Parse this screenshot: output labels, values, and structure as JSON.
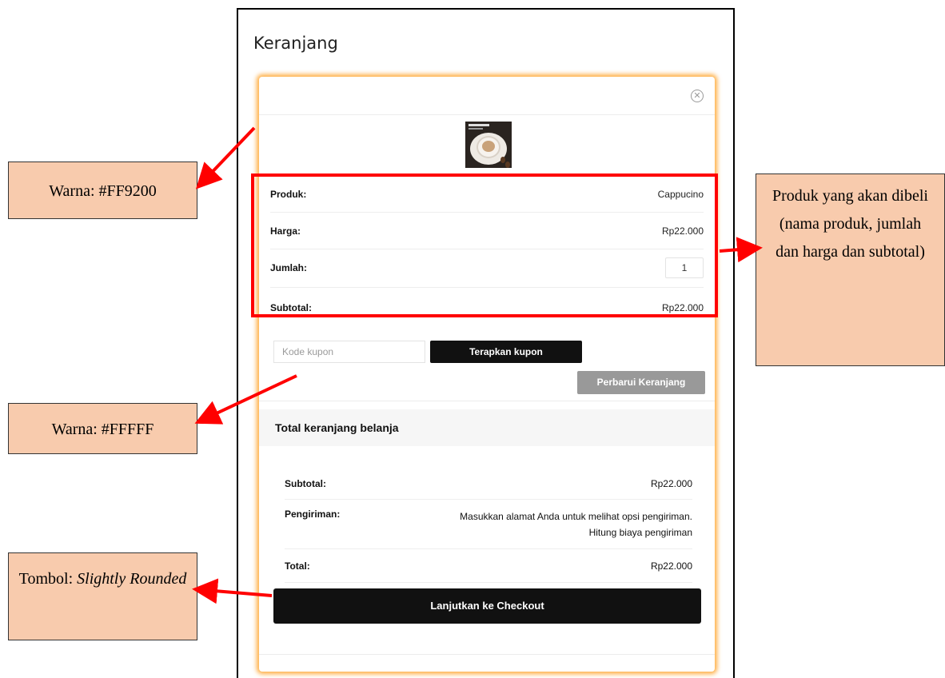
{
  "page": {
    "title": "Keranjang"
  },
  "cart": {
    "close_icon_glyph": "✕",
    "product": {
      "label": "Produk:",
      "value": "Cappucino",
      "price_label": "Harga:",
      "price_value": "Rp22.000",
      "qty_label": "Jumlah:",
      "qty_value": "1",
      "subtotal_label": "Subtotal:",
      "subtotal_value": "Rp22.000"
    },
    "coupon": {
      "placeholder": "Kode kupon",
      "apply_label": "Terapkan kupon"
    },
    "update_label": "Perbarui Keranjang"
  },
  "totals": {
    "heading": "Total keranjang belanja",
    "subtotal_label": "Subtotal:",
    "subtotal_value": "Rp22.000",
    "shipping_label": "Pengiriman:",
    "shipping_line1": "Masukkan alamat Anda untuk melihat opsi pengiriman.",
    "shipping_line2": "Hitung biaya pengiriman",
    "total_label": "Total:",
    "total_value": "Rp22.000",
    "checkout_label": "Lanjutkan ke Checkout"
  },
  "annotations": {
    "orange": "Warna: #FF9200",
    "white": "Warna: #FFFFF",
    "button_prefix": "Tombol: ",
    "button_style": "Slightly Rounded",
    "product_note": "Produk yang akan dibeli (nama produk, jumlah dan harga dan subtotal)"
  },
  "colors": {
    "accent_glow": "#FF9200",
    "annotation_bg": "#F8CBAD",
    "highlight": "#FF0000"
  }
}
